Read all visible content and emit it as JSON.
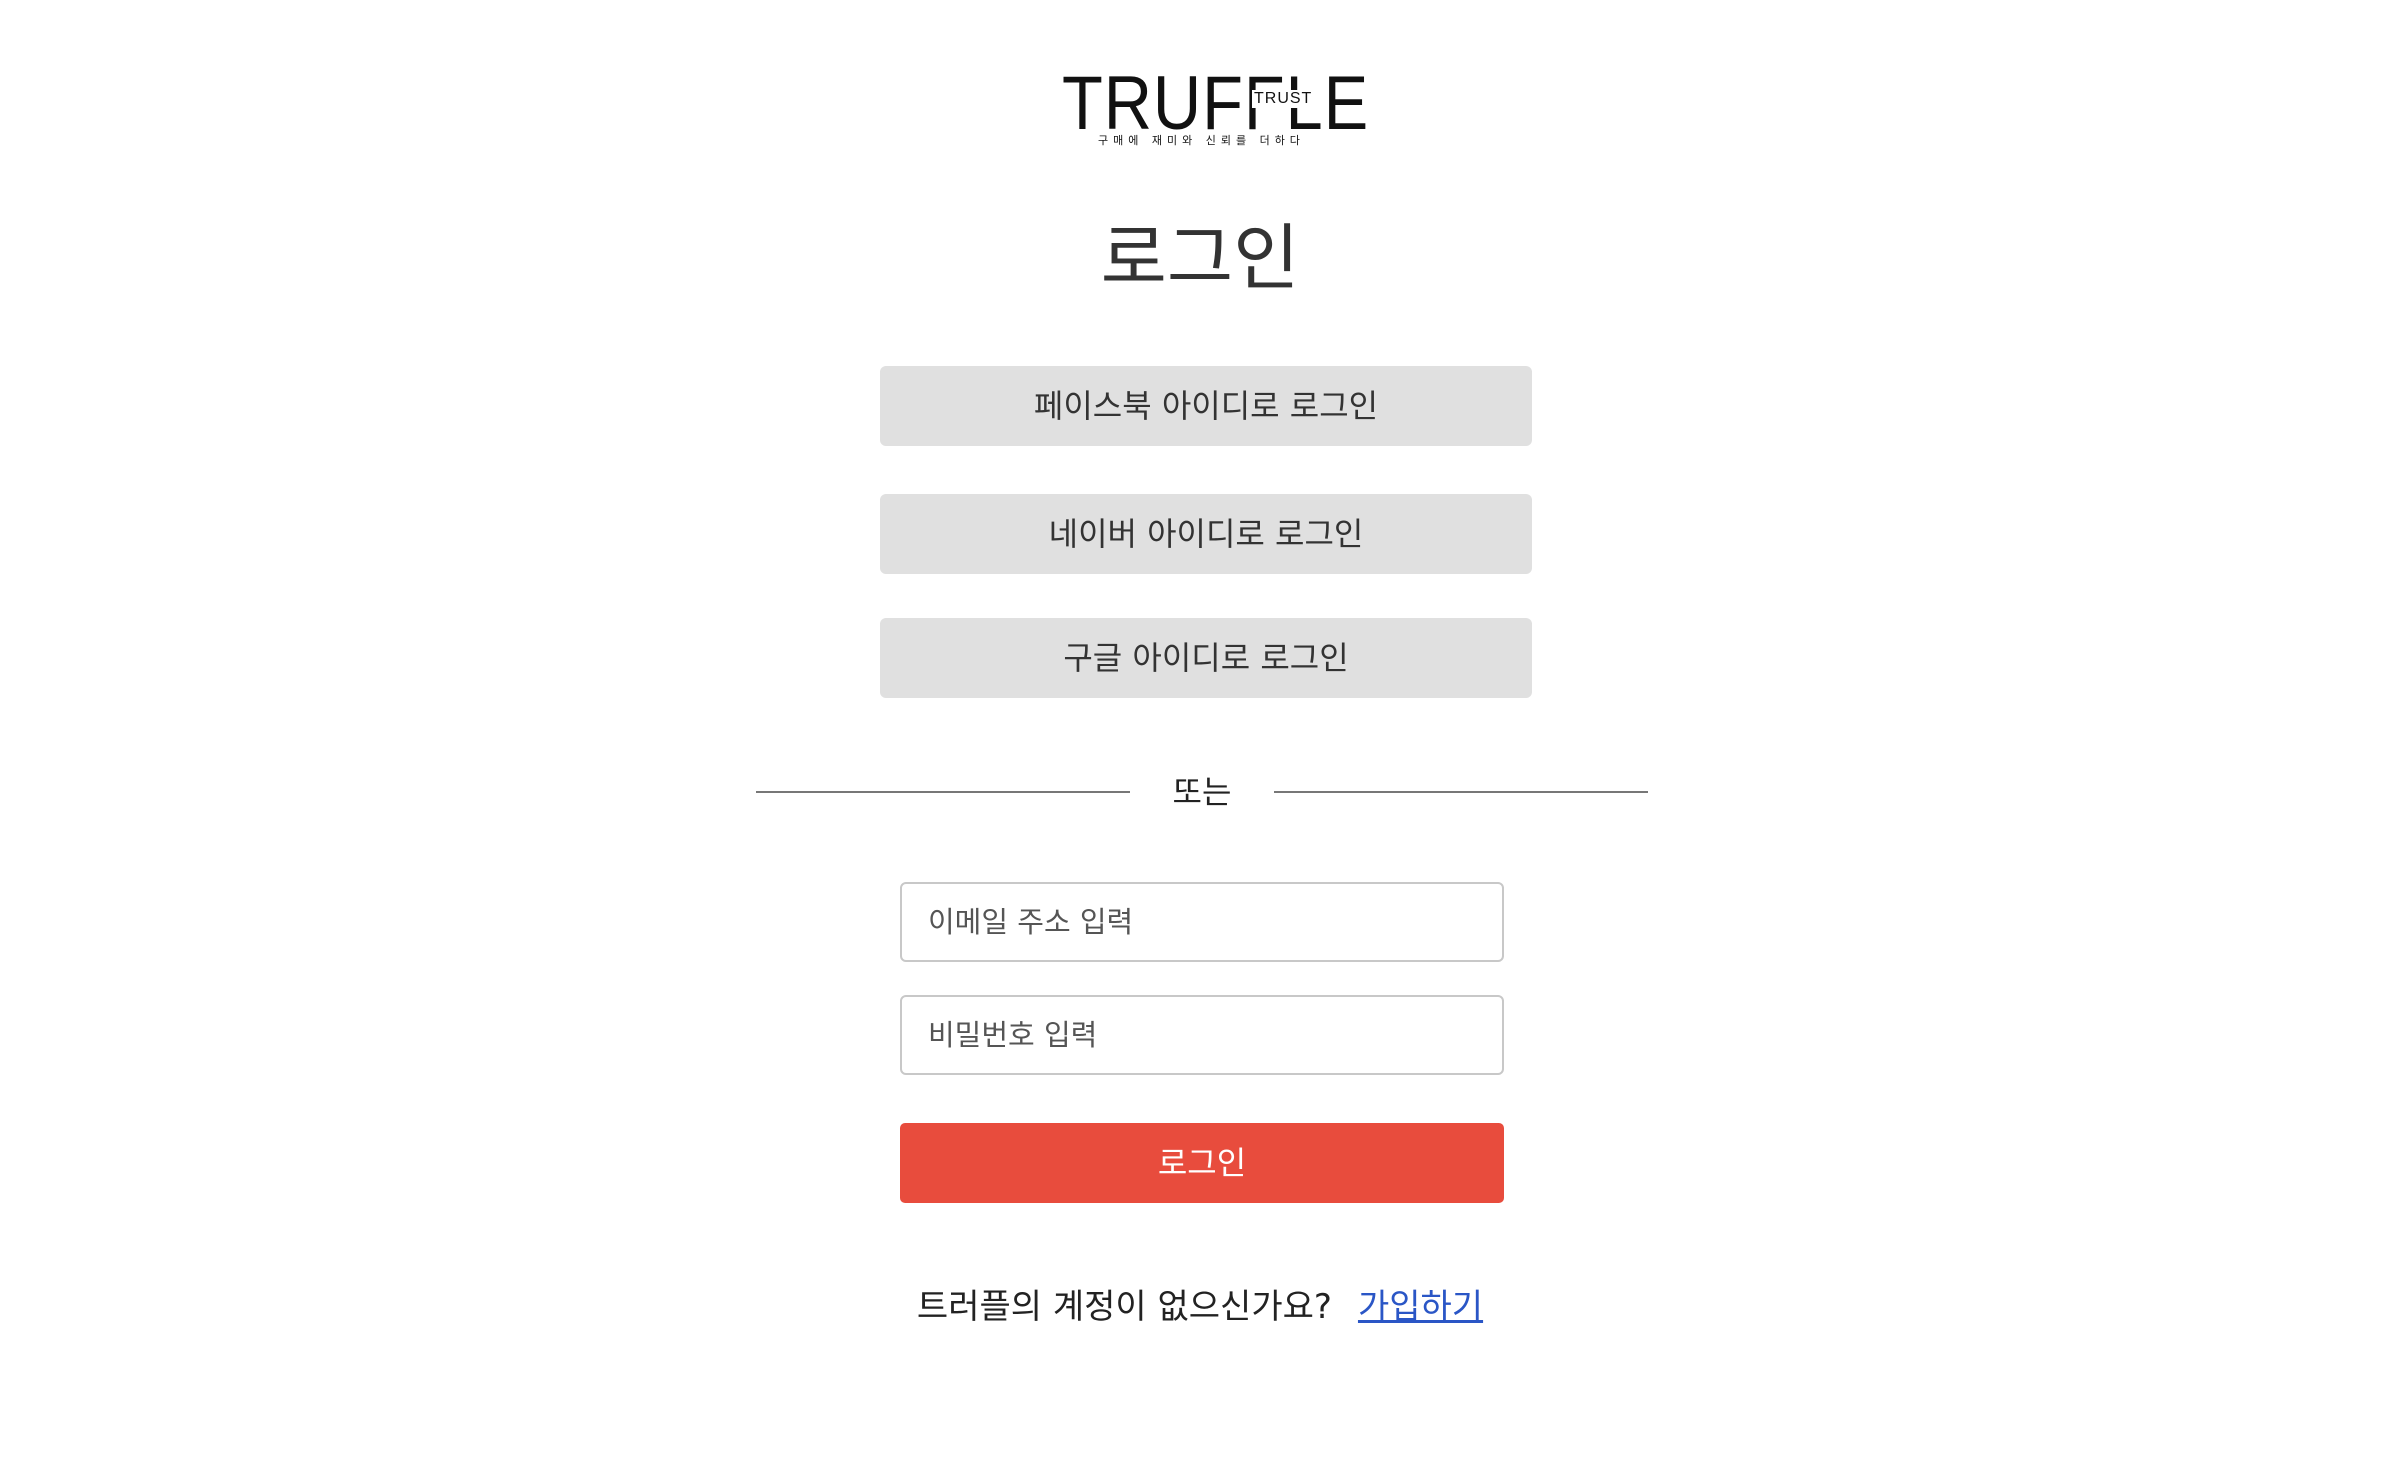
{
  "logo": {
    "wordmark": "TRUFFLE",
    "badge": "TRUST",
    "tagline": "구매에 재미와 신뢰를 더하다"
  },
  "page_title": "로그인",
  "social_login": {
    "facebook_label": "페이스북 아이디로 로그인",
    "naver_label": "네이버 아이디로 로그인",
    "google_label": "구글 아이디로 로그인"
  },
  "divider_text": "또는",
  "form": {
    "email_placeholder": "이메일 주소 입력",
    "email_value": "",
    "password_placeholder": "비밀번호 입력",
    "password_value": "",
    "submit_label": "로그인"
  },
  "signup": {
    "prompt": "트러플의 계정이 없으신가요?",
    "link_label": "가입하기"
  },
  "colors": {
    "primary_button": "#e84c3d",
    "social_button": "#e0e0e0",
    "link": "#2a56c6"
  }
}
